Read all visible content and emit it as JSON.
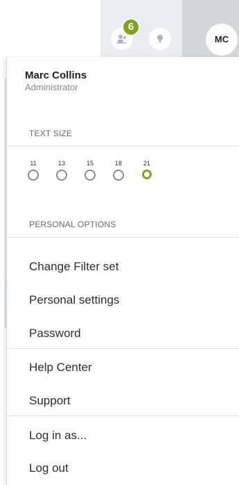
{
  "header": {
    "notification_count": "6",
    "avatar_initials": "MC",
    "icons": [
      "users-icon",
      "lightbulb-icon"
    ]
  },
  "user": {
    "name": "Marc Collins",
    "role": "Administrator"
  },
  "text_size": {
    "label": "TEXT SIZE",
    "options": [
      "11",
      "13",
      "15",
      "18",
      "21"
    ],
    "selected": "21",
    "accent_color": "#7fa51e"
  },
  "personal": {
    "label": "PERSONAL OPTIONS"
  },
  "menu": {
    "change_filter_set": "Change Filter set",
    "personal_settings": "Personal settings",
    "password": "Password",
    "help_center": "Help Center",
    "support": "Support",
    "log_in_as": "Log in as...",
    "log_out": "Log out"
  }
}
